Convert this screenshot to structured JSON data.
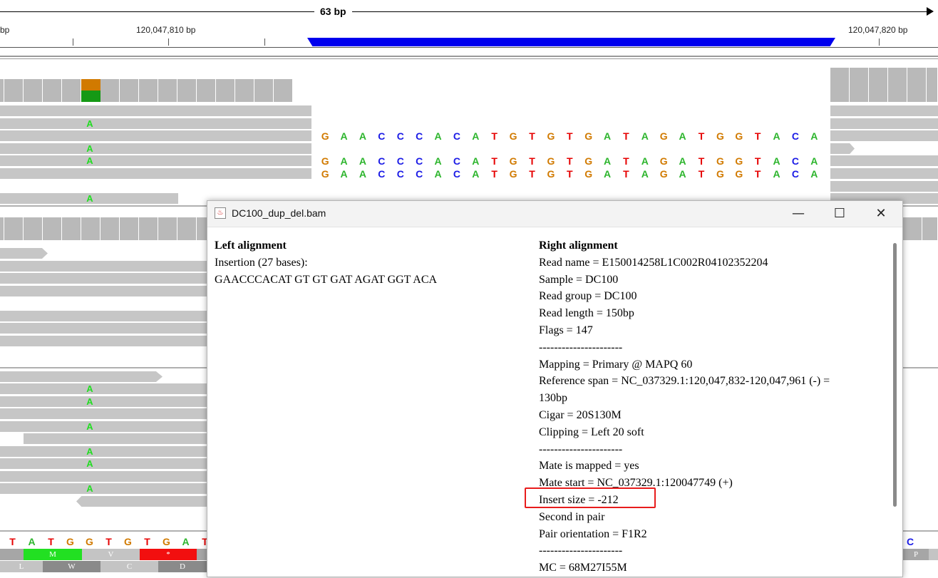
{
  "ruler": {
    "span_label": "63 bp",
    "left_partial": "bp",
    "pos1": "120,047,810 bp",
    "pos2": "120,047,820 bp"
  },
  "read_sequence": [
    "G",
    "A",
    "A",
    "C",
    "C",
    "C",
    "A",
    "C",
    "A",
    "T",
    "G",
    "T",
    "G",
    "T",
    "G",
    "A",
    "T",
    "A",
    "G",
    "A",
    "T",
    "G",
    "G",
    "T",
    "A",
    "C",
    "A"
  ],
  "mismatch_base": "A",
  "reference_sequence": [
    "T",
    "A",
    "T",
    "G",
    "G",
    "T",
    "G",
    "T",
    "G",
    "A",
    "T"
  ],
  "amino_acids": {
    "top": [
      "M",
      "V",
      "*"
    ],
    "bottom": [
      "L",
      "W",
      "C",
      "D"
    ],
    "right_top": "P",
    "right_bottom_partial": "C"
  },
  "colors": {
    "A": "#2db52d",
    "C": "#1a1ae6",
    "G": "#d17a00",
    "T": "#e60000",
    "coverage": "#b9b9b9",
    "read": "#c6c6c6",
    "insertion_bar": "#0000ee",
    "highlight": "#e81c1c"
  },
  "dialog": {
    "title": "DC100_dup_del.bam",
    "icon": "java-cup-icon",
    "minimize": "—",
    "maximize": "☐",
    "close": "✕",
    "left": {
      "heading": "Left alignment",
      "insertion": "Insertion (27 bases):",
      "sequence": "GAACCCACAT GT GT GAT AGAT GGT ACA"
    },
    "right": {
      "heading": "Right alignment",
      "lines": [
        "Read name = E150014258L1C002R04102352204",
        "Sample = DC100",
        "Read group = DC100",
        "Read length = 150bp",
        "Flags = 147",
        "----------------------",
        "Mapping = Primary @ MAPQ 60",
        "Reference span = NC_037329.1:120,047,832-120,047,961 (-) =",
        "130bp",
        "Cigar = 20S130M",
        "Clipping = Left 20 soft",
        "----------------------",
        "Mate is mapped = yes",
        "Mate start = NC_037329.1:120047749 (+)",
        "Insert size = -212",
        "Second in pair",
        "Pair orientation = F1R2",
        "----------------------",
        "MC = 68M27I55M"
      ]
    }
  }
}
